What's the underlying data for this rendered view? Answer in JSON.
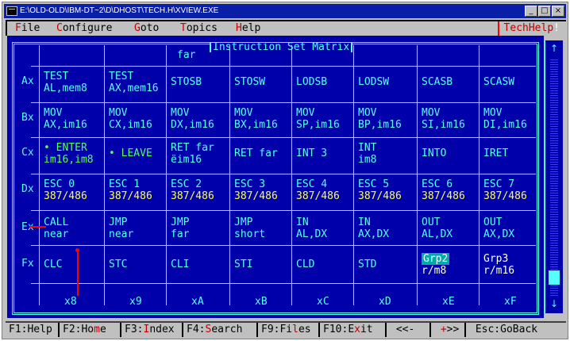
{
  "window": {
    "title": "E:\\OLD-OLD\\IBM-DT~2\\D\\DHOST\\TECH.H\\XVIEW.EXE",
    "minimize": "_",
    "maximize": "□",
    "close": "×"
  },
  "menu": {
    "items": [
      {
        "hot": "F",
        "rest": "ile"
      },
      {
        "hot": "C",
        "rest": "onfigure"
      },
      {
        "hot": "G",
        "rest": "oto"
      },
      {
        "hot": "T",
        "rest": "opics"
      },
      {
        "hot": "H",
        "rest": "elp"
      }
    ],
    "techhelp": "TechHelp",
    "techhelp_bang": "!"
  },
  "panel": {
    "title": "Instruction Set Matrix",
    "top_fragment": "far"
  },
  "matrix": {
    "row_labels": [
      "Ax",
      "Bx",
      "Cx",
      "Dx",
      "Ex",
      "Fx"
    ],
    "col_labels": [
      "x8",
      "x9",
      "xA",
      "xB",
      "xC",
      "xD",
      "xE",
      "xF"
    ],
    "rows": [
      [
        {
          "l1": "TEST",
          "l2": "AL,mem8"
        },
        {
          "l1": "TEST",
          "l2": "AX,mem16"
        },
        {
          "l1": "STOSB",
          "l2": ""
        },
        {
          "l1": "STOSW",
          "l2": ""
        },
        {
          "l1": "LODSB",
          "l2": ""
        },
        {
          "l1": "LODSW",
          "l2": ""
        },
        {
          "l1": "SCASB",
          "l2": ""
        },
        {
          "l1": "SCASW",
          "l2": ""
        }
      ],
      [
        {
          "l1": "MOV",
          "l2": "AX,im16"
        },
        {
          "l1": "MOV",
          "l2": "CX,im16"
        },
        {
          "l1": "MOV",
          "l2": "DX,im16"
        },
        {
          "l1": "MOV",
          "l2": "BX,im16"
        },
        {
          "l1": "MOV",
          "l2": "SP,im16"
        },
        {
          "l1": "MOV",
          "l2": "BP,im16"
        },
        {
          "l1": "MOV",
          "l2": "SI,im16"
        },
        {
          "l1": "MOV",
          "l2": "DI,im16"
        }
      ],
      [
        {
          "l1": "• ENTER",
          "l2": "im16,im8"
        },
        {
          "l1": "• LEAVE",
          "l2": ""
        },
        {
          "l1": "RET far",
          "l2": "ëim16"
        },
        {
          "l1": "RET far",
          "l2": ""
        },
        {
          "l1": "INT 3",
          "l2": ""
        },
        {
          "l1": "INT",
          "l2": "im8"
        },
        {
          "l1": "INTO",
          "l2": ""
        },
        {
          "l1": "IRET",
          "l2": ""
        }
      ],
      [
        {
          "l1": "ESC 0",
          "l2": "387/486"
        },
        {
          "l1": "ESC 1",
          "l2": "387/486"
        },
        {
          "l1": "ESC 2",
          "l2": "387/486"
        },
        {
          "l1": "ESC 3",
          "l2": "387/486"
        },
        {
          "l1": "ESC 4",
          "l2": "387/486"
        },
        {
          "l1": "ESC 5",
          "l2": "387/486"
        },
        {
          "l1": "ESC 6",
          "l2": "387/486"
        },
        {
          "l1": "ESC 7",
          "l2": "387/486"
        }
      ],
      [
        {
          "l1": "CALL",
          "l2": "near"
        },
        {
          "l1": "JMP",
          "l2": "near"
        },
        {
          "l1": "JMP",
          "l2": "far"
        },
        {
          "l1": "JMP",
          "l2": "short"
        },
        {
          "l1": "IN",
          "l2": "AL,DX"
        },
        {
          "l1": "IN",
          "l2": "AX,DX"
        },
        {
          "l1": "OUT",
          "l2": "AL,DX"
        },
        {
          "l1": "OUT",
          "l2": "AX,DX"
        }
      ],
      [
        {
          "l1": "CLC",
          "l2": ""
        },
        {
          "l1": "STC",
          "l2": ""
        },
        {
          "l1": "CLI",
          "l2": ""
        },
        {
          "l1": "STI",
          "l2": ""
        },
        {
          "l1": "CLD",
          "l2": ""
        },
        {
          "l1": "STD",
          "l2": ""
        },
        {
          "l1": "Grp2",
          "l2": "r/m8"
        },
        {
          "l1": "Grp3",
          "l2": "r/m16"
        }
      ]
    ]
  },
  "scrollbar": {
    "up": "↑",
    "down": "↓"
  },
  "status": [
    {
      "key": "F1",
      "sep": ":",
      "pre": "",
      "hot": "",
      "post": "Help"
    },
    {
      "key": "F2",
      "sep": ":",
      "pre": "Ho",
      "hot": "m",
      "post": "e"
    },
    {
      "key": "F3",
      "sep": ":",
      "pre": "",
      "hot": "I",
      "post": "ndex"
    },
    {
      "key": "F4",
      "sep": ":",
      "pre": "",
      "hot": "S",
      "post": "earch"
    },
    {
      "key": "F9",
      "sep": ":",
      "pre": "Fi",
      "hot": "l",
      "post": "es"
    },
    {
      "key": "F10",
      "sep": ":",
      "pre": "E",
      "hot": "x",
      "post": "it"
    },
    {
      "key": "",
      "sep": "",
      "pre": " <<- ",
      "hot": "",
      "post": ""
    },
    {
      "key": "",
      "sep": "",
      "pre": " ",
      "hot": "+",
      "post": ">> "
    },
    {
      "key": "",
      "sep": "",
      "pre": " Esc:GoBack",
      "hot": "",
      "post": ""
    }
  ],
  "colors": {
    "screen_bg": "#0000aa",
    "text_cyan": "#55ffff",
    "text_yellow": "#ffff55",
    "text_green": "#55ff55",
    "highlight": "#00aaaa",
    "hotkey_red": "#c00000"
  }
}
